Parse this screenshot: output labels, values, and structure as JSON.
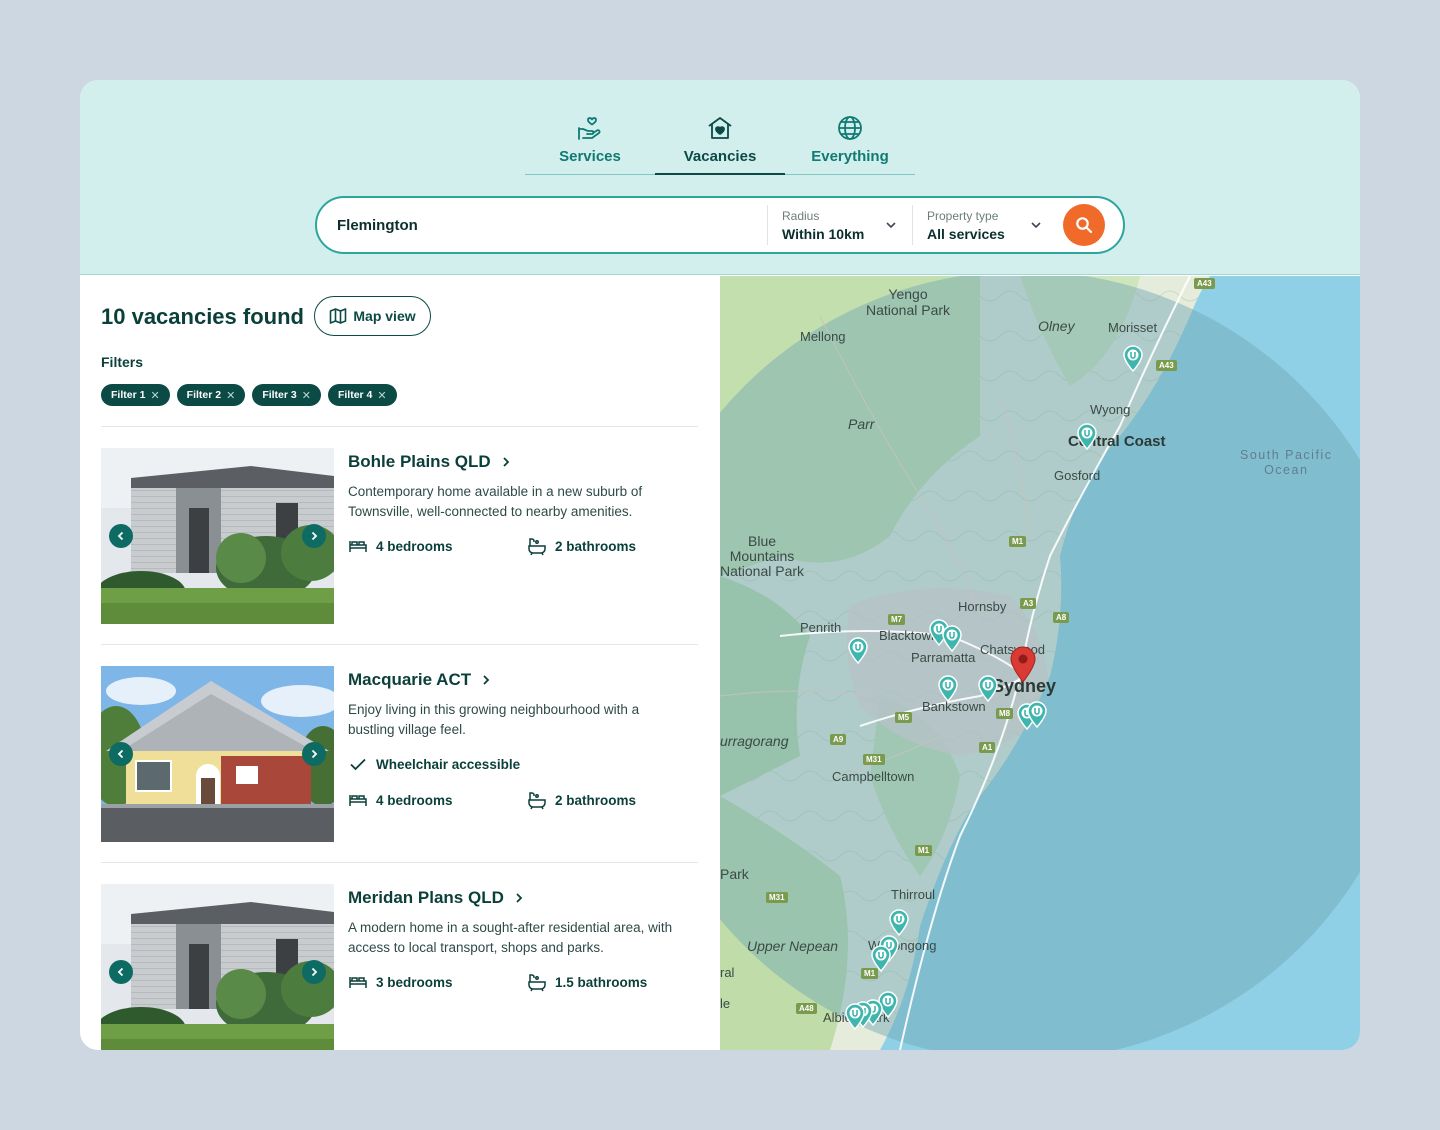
{
  "tabs": [
    {
      "label": "Services",
      "icon": "hand-heart-icon"
    },
    {
      "label": "Vacancies",
      "icon": "house-heart-icon",
      "active": true
    },
    {
      "label": "Everything",
      "icon": "globe-icon"
    }
  ],
  "search": {
    "location": "Flemington",
    "radius_label": "Radius",
    "radius_value": "Within 10km",
    "type_label": "Property type",
    "type_value": "All services"
  },
  "results": {
    "title": "10 vacancies found",
    "map_button": "Map view",
    "filters_label": "Filters",
    "filters": [
      "Filter 1",
      "Filter 2",
      "Filter 3",
      "Filter 4"
    ]
  },
  "listings": [
    {
      "title": "Bohle Plains QLD",
      "desc": "Contemporary home available in a new suburb of Townsville, well-connected to nearby amenities.",
      "bedrooms": "4 bedrooms",
      "bathrooms": "2 bathrooms"
    },
    {
      "title": "Macquarie ACT",
      "desc": "Enjoy living in this growing neighbourhood with a bustling village feel.",
      "accessible": "Wheelchair accessible",
      "bedrooms": "4 bedrooms",
      "bathrooms": "2 bathrooms"
    },
    {
      "title": "Meridan Plans QLD",
      "desc": "A modern home in a sought-after residential area, with access to local transport, shops and parks.",
      "bedrooms": "3 bedrooms",
      "bathrooms": "1.5 bathrooms"
    }
  ],
  "map": {
    "labels": {
      "yengo": "Yengo\nNational Park",
      "mellong": "Mellong",
      "olney": "Olney",
      "morisset": "Morisset",
      "wyong": "Wyong",
      "central_coast": "Central Coast",
      "gosford": "Gosford",
      "parr": "Parr",
      "ocean": "South Pacific\nOcean",
      "blue_mountains": "Blue\nMountains\nNational Park",
      "hornsby": "Hornsby",
      "penrith": "Penrith",
      "blacktown": "Blacktown",
      "parramatta": "Parramatta",
      "chatswood": "Chatswood",
      "sydney": "Sydney",
      "bankstown": "Bankstown",
      "burragorang": "urragorang",
      "campbelltown": "Campbelltown",
      "park": "Park",
      "thirroul": "Thirroul",
      "upper_nepean": "Upper Nepean",
      "wollongong": "Wollongong",
      "ral": "ral",
      "le": "le",
      "albion_park": "Albion Park"
    },
    "roads": [
      "A43",
      "A43",
      "M1",
      "A3",
      "A8",
      "M7",
      "M5",
      "M8",
      "A1",
      "A9",
      "M31",
      "M1",
      "M31",
      "M1",
      "A48"
    ],
    "colors": {
      "ocean": "#8fd0e6",
      "radius": "#6fa7b3",
      "land": "#e6ecdc",
      "forest": "#b9d9a4",
      "pin": "#3fb6ad",
      "center_pin": "#d93a34"
    }
  }
}
